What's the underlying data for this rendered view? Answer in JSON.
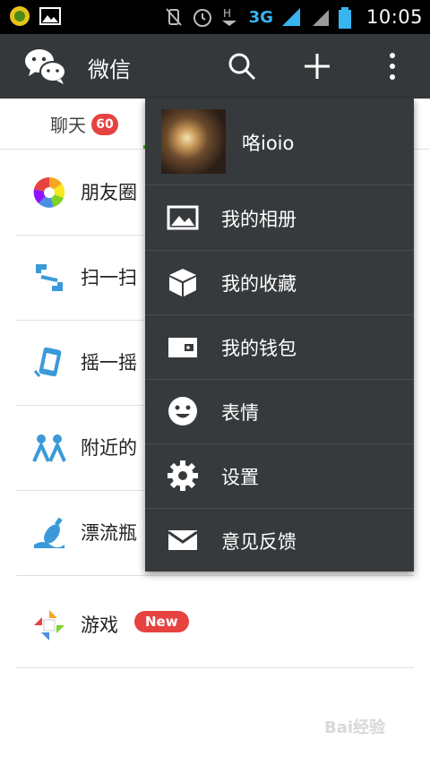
{
  "status_bar": {
    "network": "3G",
    "h_label": "H",
    "time": "10:05"
  },
  "app_bar": {
    "title": "微信"
  },
  "tabs": {
    "chat_label": "聊天",
    "chat_badge": "60"
  },
  "discover": {
    "items": [
      {
        "label": "朋友圈",
        "icon": "moments-icon"
      },
      {
        "label": "扫一扫",
        "icon": "scan-icon"
      },
      {
        "label": "摇一摇",
        "icon": "shake-icon"
      },
      {
        "label": "附近的",
        "icon": "people-nearby-icon"
      },
      {
        "label": "漂流瓶",
        "icon": "drift-bottle-icon"
      },
      {
        "label": "游戏",
        "icon": "games-icon",
        "badge": "New"
      }
    ]
  },
  "menu": {
    "profile_name": "咯ioio",
    "items": [
      {
        "label": "我的相册",
        "icon": "album-icon"
      },
      {
        "label": "我的收藏",
        "icon": "favorites-icon"
      },
      {
        "label": "我的钱包",
        "icon": "wallet-icon"
      },
      {
        "label": "表情",
        "icon": "emoji-icon"
      },
      {
        "label": "设置",
        "icon": "settings-icon"
      },
      {
        "label": "意见反馈",
        "icon": "feedback-icon"
      }
    ]
  },
  "watermark": "Bai经验",
  "colors": {
    "appbar": "#34383a",
    "menu": "#373a3c",
    "badge": "#e64340",
    "accent": "#38b4f0"
  }
}
